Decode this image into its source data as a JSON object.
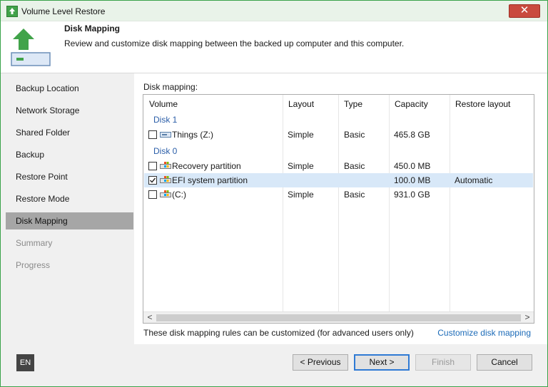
{
  "window": {
    "title": "Volume Level Restore",
    "close_symbol": "✕"
  },
  "header": {
    "title": "Disk Mapping",
    "description": "Review and customize disk mapping between the backed up computer and this computer."
  },
  "sidebar": {
    "items": [
      {
        "label": "Backup Location",
        "state": "normal"
      },
      {
        "label": "Network Storage",
        "state": "normal"
      },
      {
        "label": "Shared Folder",
        "state": "normal"
      },
      {
        "label": "Backup",
        "state": "normal"
      },
      {
        "label": "Restore Point",
        "state": "normal"
      },
      {
        "label": "Restore Mode",
        "state": "normal"
      },
      {
        "label": "Disk Mapping",
        "state": "active"
      },
      {
        "label": "Summary",
        "state": "disabled"
      },
      {
        "label": "Progress",
        "state": "disabled"
      }
    ]
  },
  "main": {
    "section_label": "Disk mapping:",
    "columns": [
      "Volume",
      "Layout",
      "Type",
      "Capacity",
      "Restore layout"
    ],
    "groups": [
      {
        "name": "Disk 1",
        "rows": [
          {
            "checked": false,
            "icon": "drive-icon",
            "volume": "Things (Z:)",
            "layout": "Simple",
            "type": "Basic",
            "capacity": "465.8 GB",
            "restore_layout": ""
          }
        ]
      },
      {
        "name": "Disk 0",
        "rows": [
          {
            "checked": false,
            "icon": "windows-drive-icon",
            "volume": "Recovery partition",
            "layout": "Simple",
            "type": "Basic",
            "capacity": "450.0 MB",
            "restore_layout": ""
          },
          {
            "checked": true,
            "icon": "windows-drive-icon",
            "volume": "EFI system partition",
            "layout": "",
            "type": "",
            "capacity": "100.0 MB",
            "restore_layout": "Automatic"
          },
          {
            "checked": false,
            "icon": "windows-drive-icon",
            "volume": "(C:)",
            "layout": "Simple",
            "type": "Basic",
            "capacity": "931.0 GB",
            "restore_layout": ""
          }
        ]
      }
    ],
    "footnote": "These disk mapping rules can be customized (for advanced users only)",
    "customize_link": "Customize disk mapping",
    "scroll_left": "<",
    "scroll_right": ">"
  },
  "footer": {
    "language": "EN",
    "previous_label": "< Previous",
    "next_label": "Next >",
    "finish_label": "Finish",
    "cancel_label": "Cancel"
  },
  "colors": {
    "accent_green": "#41a34a",
    "active_nav": "#a6a6a6",
    "selected_row": "#d8e8f8",
    "link": "#1c6bb8",
    "group_header": "#2b5ea8"
  }
}
